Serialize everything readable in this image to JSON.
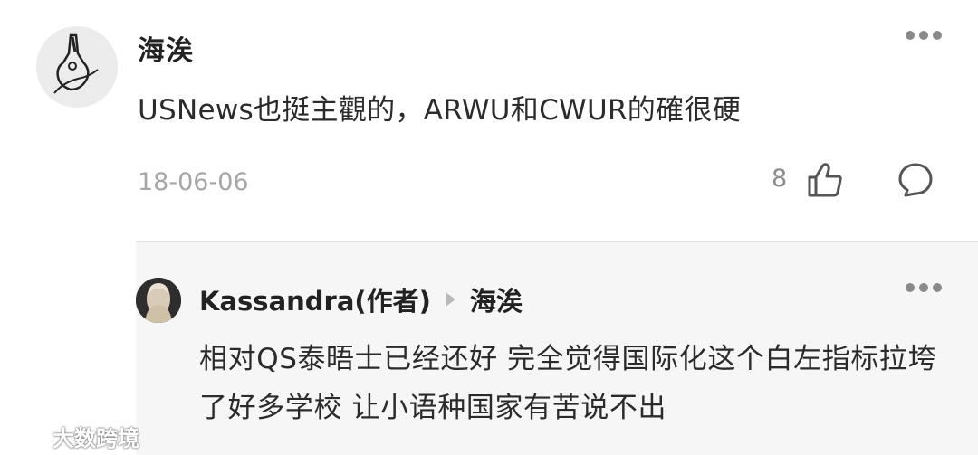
{
  "main_comment": {
    "author": "海涘",
    "text": "USNews也挺主觀的，ARWU和CWUR的確很硬",
    "date": "18-06-06",
    "like_count": "8"
  },
  "reply": {
    "author": "Kassandra(作者)",
    "reply_to": "海涘",
    "text": "相对QS泰晤士已经还好 完全觉得国际化这个白左指标拉垮了好多学校 让小语种国家有苦说不出"
  },
  "watermark": {
    "text": "大数跨境"
  },
  "icons": {
    "more": "more-icon",
    "like": "thumbs-up-icon",
    "comment": "comment-bubble-icon"
  }
}
